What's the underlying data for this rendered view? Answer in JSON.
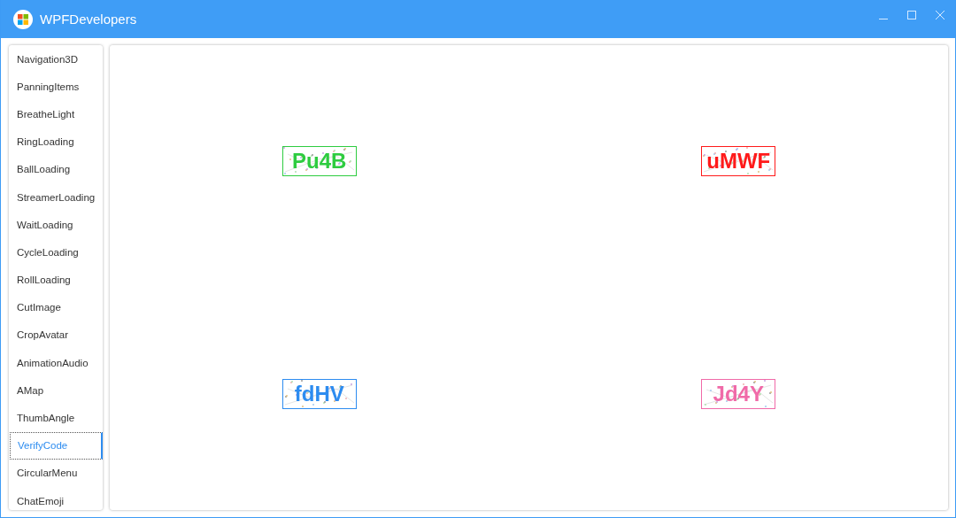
{
  "window": {
    "title": "WPFDevelopers"
  },
  "sidebar": {
    "items": [
      {
        "label": "Navigation3D",
        "selected": false
      },
      {
        "label": "PanningItems",
        "selected": false
      },
      {
        "label": "BreatheLight",
        "selected": false
      },
      {
        "label": "RingLoading",
        "selected": false
      },
      {
        "label": "BallLoading",
        "selected": false
      },
      {
        "label": "StreamerLoading",
        "selected": false
      },
      {
        "label": "WaitLoading",
        "selected": false
      },
      {
        "label": "CycleLoading",
        "selected": false
      },
      {
        "label": "RollLoading",
        "selected": false
      },
      {
        "label": "CutImage",
        "selected": false
      },
      {
        "label": "CropAvatar",
        "selected": false
      },
      {
        "label": "AnimationAudio",
        "selected": false
      },
      {
        "label": "AMap",
        "selected": false
      },
      {
        "label": "ThumbAngle",
        "selected": false
      },
      {
        "label": "VerifyCode",
        "selected": true
      },
      {
        "label": "CircularMenu",
        "selected": false
      },
      {
        "label": "ChatEmoji",
        "selected": false
      }
    ]
  },
  "verify_codes": [
    {
      "code": "Pu4B",
      "color": "#2ecc40"
    },
    {
      "code": "uMWF",
      "color": "#ff1a1a"
    },
    {
      "code": "fdHV",
      "color": "#2d8cf0"
    },
    {
      "code": "Jd4Y",
      "color": "#f06aa8"
    }
  ]
}
